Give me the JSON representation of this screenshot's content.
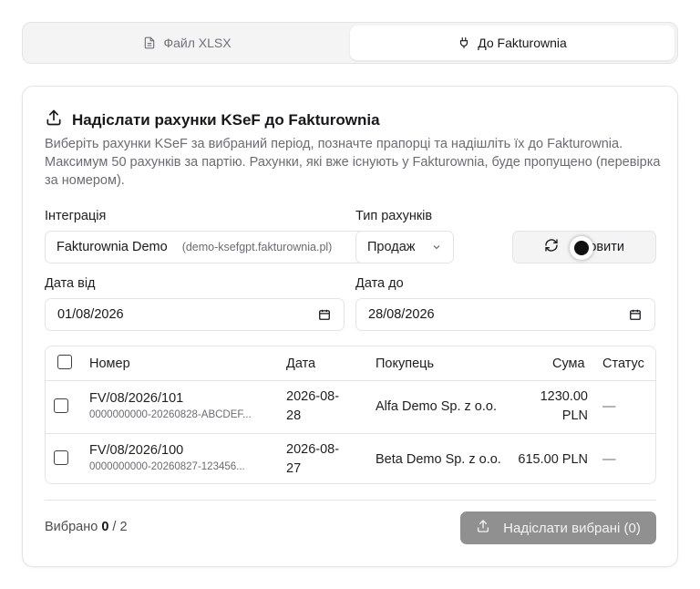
{
  "tabs": [
    {
      "label": "Файл XLSX",
      "icon": "file-icon",
      "active": false
    },
    {
      "label": "До Fakturownia",
      "icon": "plug-icon",
      "active": true
    }
  ],
  "card": {
    "title": "Надіслати рахунки KSeF до Fakturownia",
    "description": "Виберіть рахунки KSeF за вибраний період, позначте прапорці та надішліть їх до Fakturownia. Максимум 50 рахунків за партію. Рахунки, які вже існують у Fakturownia, буде пропущено (перевірка за номером)."
  },
  "form": {
    "integration_label": "Інтеграція",
    "integration_name": "Fakturownia Demo",
    "integration_domain": "(demo-ksefgpt.fakturownia.pl)",
    "type_label": "Тип рахунків",
    "type_value": "Продаж",
    "refresh_label": "Оновити",
    "date_from_label": "Дата від",
    "date_from_value": "01/08/2026",
    "date_to_label": "Дата до",
    "date_to_value": "28/08/2026"
  },
  "table": {
    "headers": {
      "number": "Номер",
      "date": "Дата",
      "buyer": "Покупець",
      "amount": "Сума",
      "status": "Статус"
    },
    "rows": [
      {
        "number": "FV/08/2026/101",
        "ksef_id": "0000000000-20260828-ABCDEF...",
        "date_line1": "2026-08-",
        "date_line2": "28",
        "buyer": "Alfa Demo Sp. z o.o.",
        "amount_line1": "1230.00",
        "amount_line2": "PLN",
        "status": "—"
      },
      {
        "number": "FV/08/2026/100",
        "ksef_id": "0000000000-20260827-123456...",
        "date_line1": "2026-08-",
        "date_line2": "27",
        "buyer": "Beta Demo Sp. z o.o.",
        "amount_line1": "615.00 PLN",
        "amount_line2": "",
        "status": "—"
      }
    ]
  },
  "footer": {
    "selected_prefix": "Вибрано",
    "selected_count": "0",
    "selected_total": "/ 2",
    "send_label": "Надіслати вибрані (0)"
  },
  "colors": {
    "send_button": "#909090",
    "border": "#e4e4e7",
    "muted_text": "#6b6b73"
  }
}
